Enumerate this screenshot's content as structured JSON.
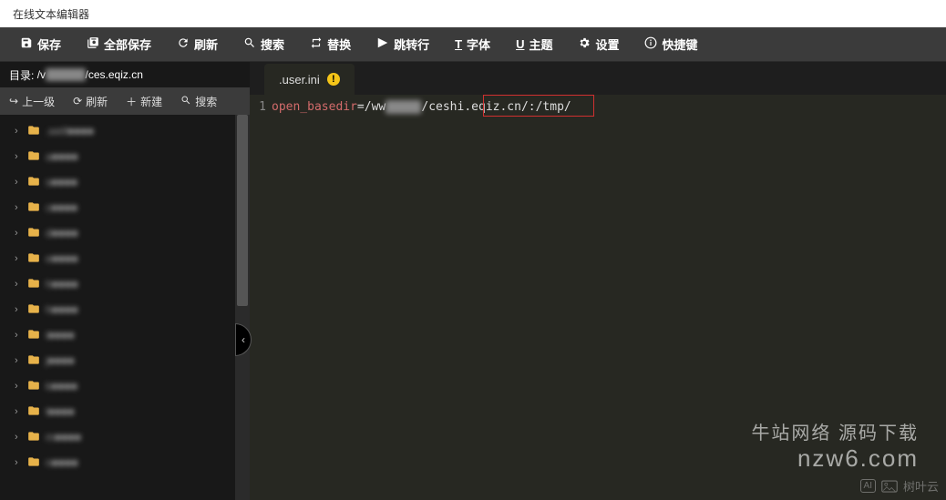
{
  "window": {
    "title": "在线文本编辑器"
  },
  "toolbar": {
    "save": "保存",
    "save_all": "全部保存",
    "refresh": "刷新",
    "search": "搜索",
    "replace": "替换",
    "goto": "跳转行",
    "font": "字体",
    "theme": "主题",
    "settings": "设置",
    "shortcuts": "快捷键"
  },
  "sidebar": {
    "path_label": "目录:",
    "path_prefix": "/v",
    "path_hidden": "■■■■■■",
    "path_suffix": "/ces.eqiz.cn",
    "up": "上一级",
    "refresh": "刷新",
    "new": "新建",
    "search": "搜索",
    "items": [
      {
        "label": ".well"
      },
      {
        "label": "a"
      },
      {
        "label": "s"
      },
      {
        "label": "c"
      },
      {
        "label": "d"
      },
      {
        "label": "e"
      },
      {
        "label": "h"
      },
      {
        "label": "h"
      },
      {
        "label": "i"
      },
      {
        "label": "j"
      },
      {
        "label": "k"
      },
      {
        "label": "l"
      },
      {
        "label": "m"
      },
      {
        "label": "n"
      }
    ]
  },
  "tabs": [
    {
      "name": ".user.ini",
      "modified": true
    }
  ],
  "code": {
    "line1_no": "1",
    "keyword": "open_basedir",
    "eq": "=/ww",
    "hidden": "■■■■■",
    "part2": "/ceshi.eqiz.cn/",
    "part3": ":/tmp/"
  },
  "watermark": {
    "l1": "牛站网络 源码下载",
    "l2": "nzw6.com"
  },
  "brand": {
    "text": "树叶云",
    "tag": "AI"
  }
}
